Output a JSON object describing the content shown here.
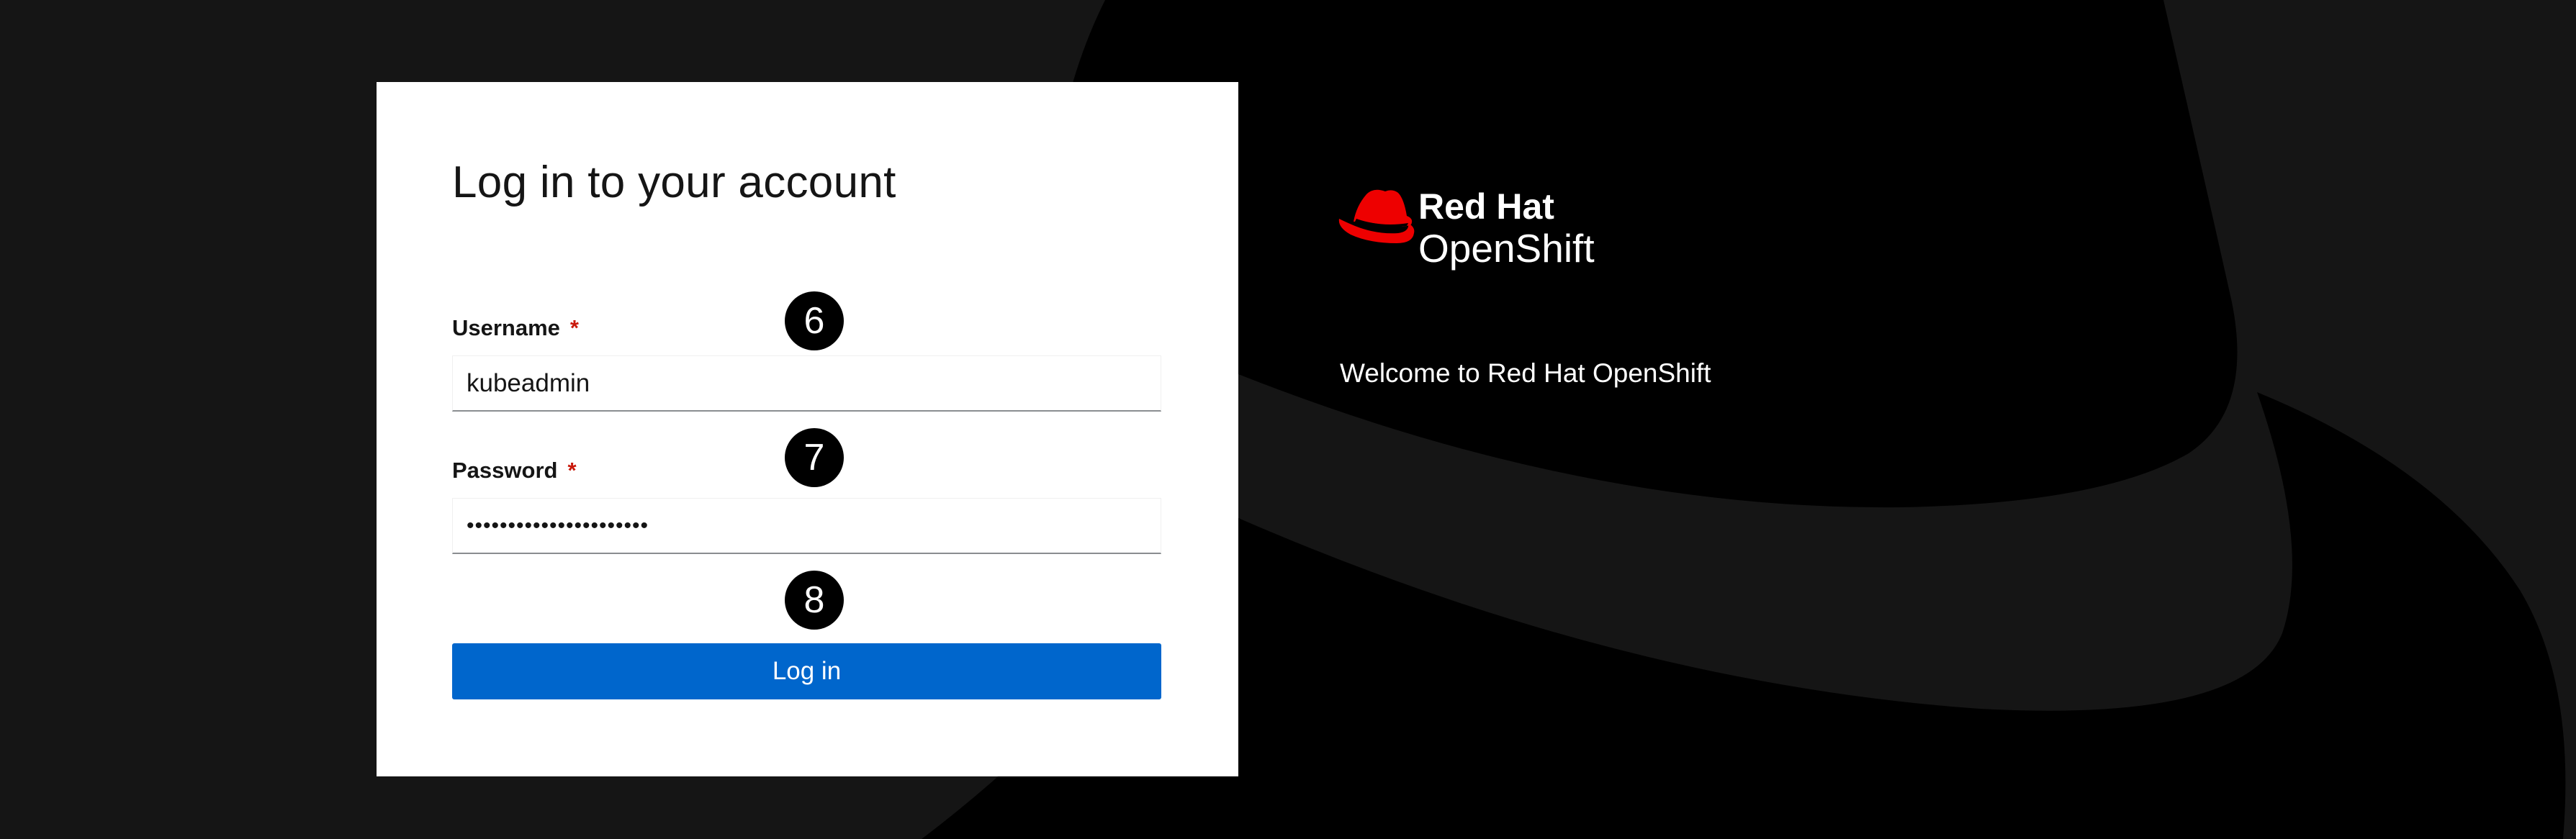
{
  "login": {
    "title": "Log in to your account",
    "username": {
      "label": "Username",
      "required_mark": "*",
      "value": "kubeadmin"
    },
    "password": {
      "label": "Password",
      "required_mark": "*",
      "value": "••••••••••••••••••••••"
    },
    "submit_label": "Log in"
  },
  "step_badges": {
    "username": "6",
    "password": "7",
    "submit": "8"
  },
  "brand": {
    "line1": "Red Hat",
    "line2": "OpenShift",
    "icon": "red-hat-fedora-icon"
  },
  "welcome_text": "Welcome to Red Hat OpenShift",
  "colors": {
    "page_background": "#151515",
    "hat_shape": "#000000",
    "primary_button": "#0066cc",
    "required_star": "#c9190b",
    "brand_red": "#ee0000"
  }
}
